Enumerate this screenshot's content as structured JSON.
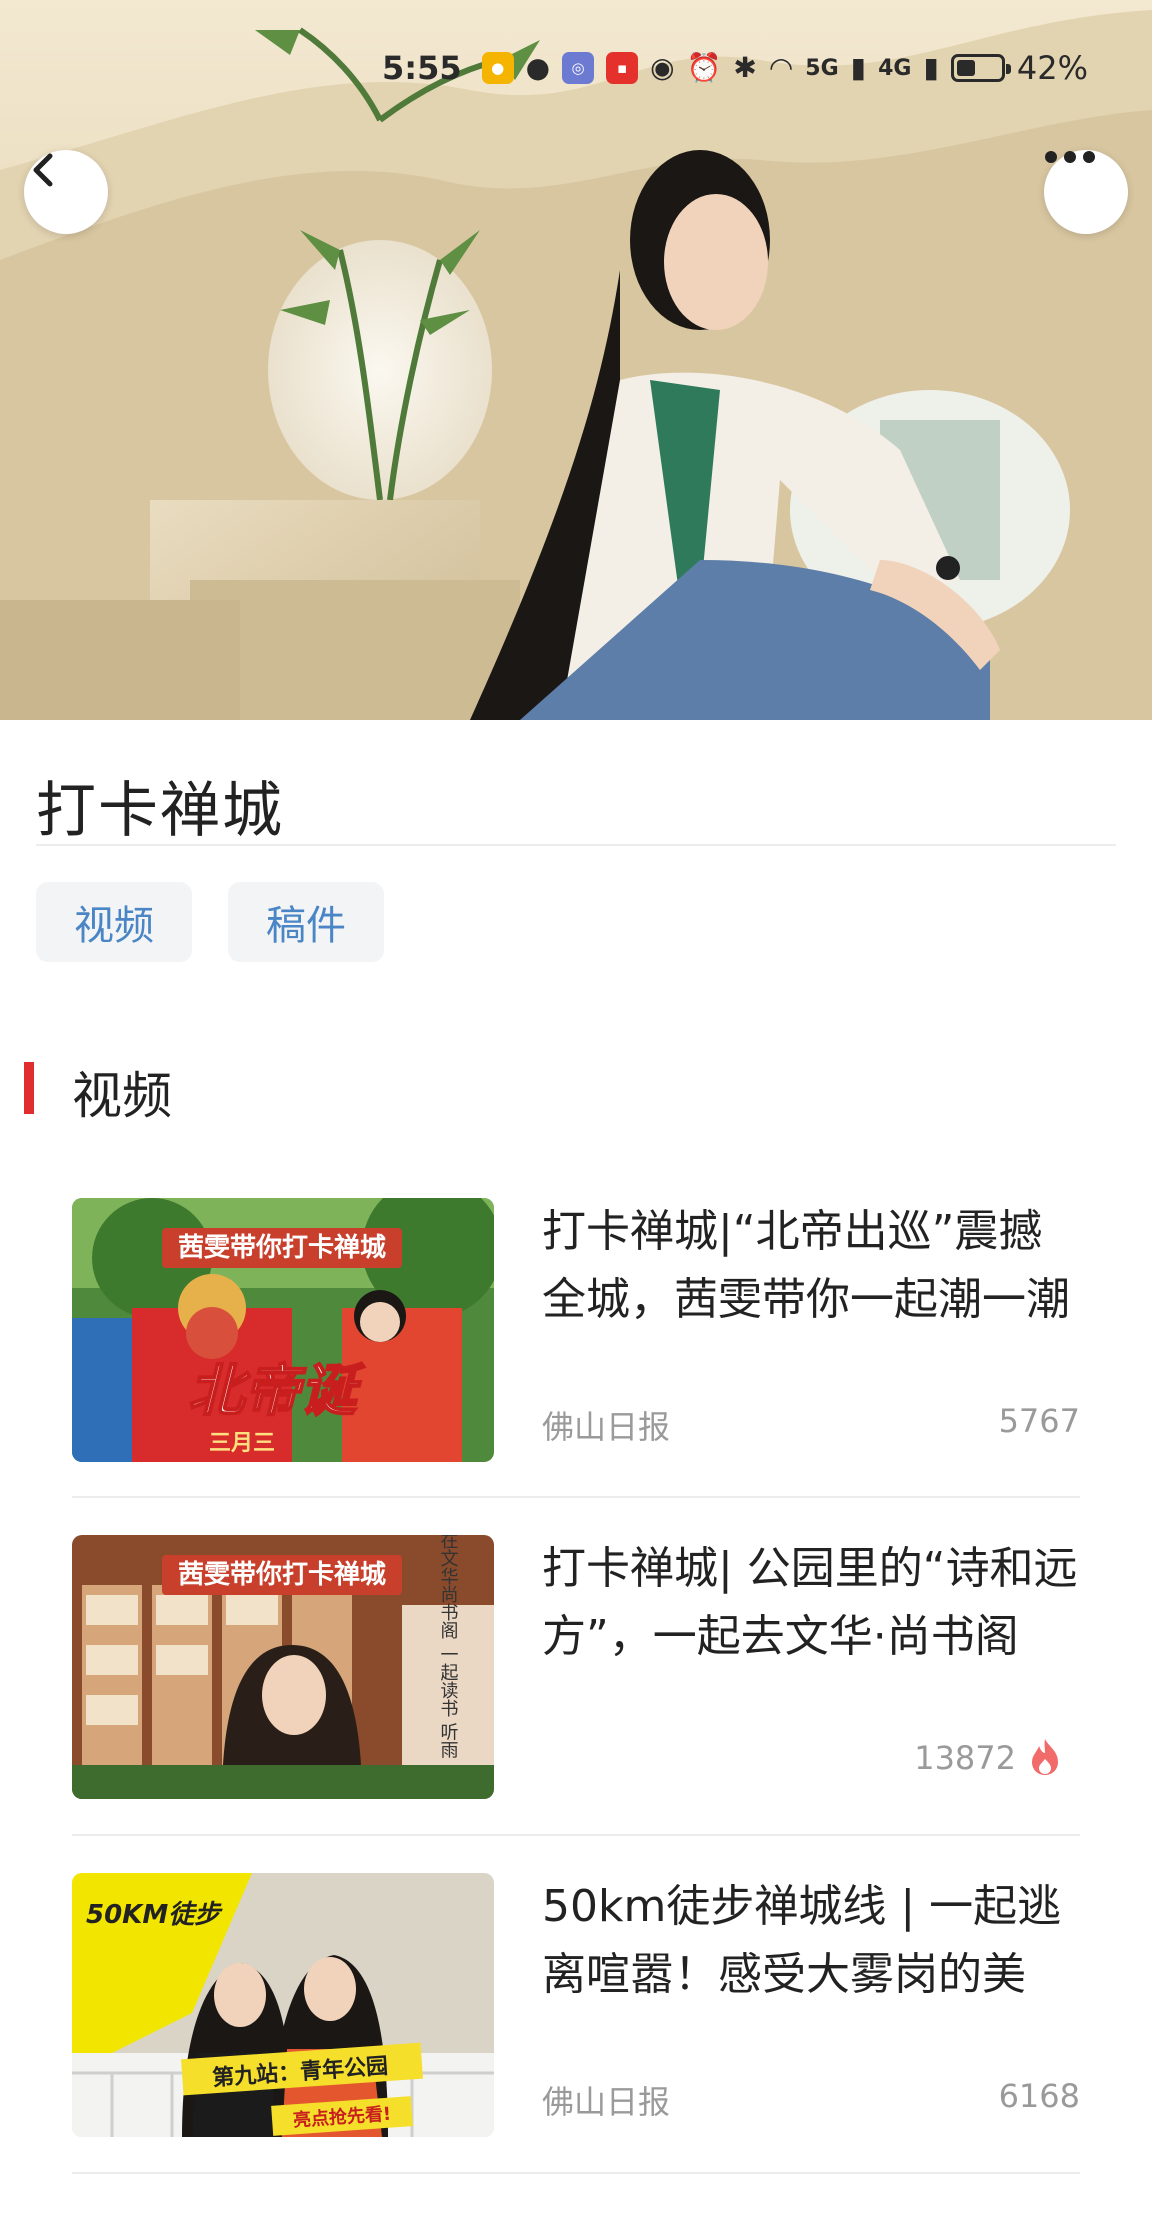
{
  "status_bar": {
    "time": "5:55",
    "icons": [
      "weibo-icon",
      "chat-bubble-icon",
      "app-icon",
      "app-icon-red",
      "eye-icon",
      "alarm-icon",
      "bluetooth-icon",
      "wifi-icon",
      "signal-5g-icon",
      "signal-4g-icon",
      "battery-icon"
    ],
    "signal_5g_label": "5G",
    "signal_4g_label": "4G",
    "battery_level": 0.42,
    "battery_text": "42%"
  },
  "header": {
    "back_icon": "chevron-left-icon",
    "more_icon": "more-dots-icon"
  },
  "page": {
    "title": "打卡禅城"
  },
  "tabs": [
    {
      "label": "视频"
    },
    {
      "label": "稿件"
    }
  ],
  "section": {
    "title": "视频"
  },
  "videos": [
    {
      "title": "打卡禅城|“北帝出巡”震撼全城，茜雯带你一起潮一潮",
      "source": "佛山日报",
      "count": "5767",
      "hot": false,
      "thumb_banner": "茜雯带你打卡禅城",
      "thumb_caption": "北帝诞",
      "thumb_sub": "三月三"
    },
    {
      "title": "打卡禅城| 公园里的“诗和远方”，一起去文华·尚书阁",
      "source": "",
      "count": "13872",
      "hot": true,
      "thumb_banner": "茜雯带你打卡禅城",
      "thumb_caption": "在文华尚书阁 一起读书 听雨"
    },
    {
      "title": "50km徒步禅城线 | 一起逃离喧嚣！感受大雾岗的美",
      "source": "佛山日报",
      "count": "6168",
      "hot": false,
      "thumb_banner": "50KM徒步",
      "thumb_caption": "第九站：青年公园",
      "thumb_sub": "亮点抢先看!"
    }
  ],
  "colors": {
    "accent": "#e02e2e",
    "tab_text": "#4a86c5",
    "tab_bg": "#f3f4f6",
    "meta_text": "#9a9a9a",
    "hot": "#f26b6b"
  }
}
